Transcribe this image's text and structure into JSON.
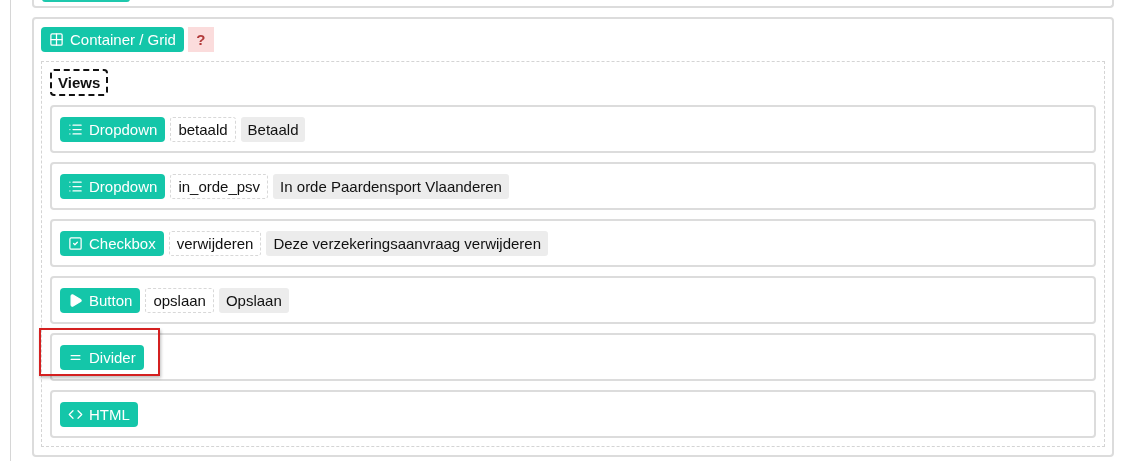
{
  "container": {
    "kind": "grid",
    "type_label": "Container / Grid",
    "help": "?",
    "section_label": "Views",
    "items": [
      {
        "kind": "dropdown",
        "type_label": "Dropdown",
        "key": "betaald",
        "label": "Betaald",
        "highlighted": false
      },
      {
        "kind": "dropdown",
        "type_label": "Dropdown",
        "key": "in_orde_psv",
        "label": "In orde Paardensport Vlaanderen",
        "highlighted": false
      },
      {
        "kind": "checkbox",
        "type_label": "Checkbox",
        "key": "verwijderen",
        "label": "Deze verzekeringsaanvraag verwijderen",
        "highlighted": false
      },
      {
        "kind": "button",
        "type_label": "Button",
        "key": "opslaan",
        "label": "Opslaan",
        "highlighted": false
      },
      {
        "kind": "divider",
        "type_label": "Divider",
        "highlighted": true
      },
      {
        "kind": "html",
        "type_label": "HTML",
        "highlighted": false
      }
    ]
  }
}
